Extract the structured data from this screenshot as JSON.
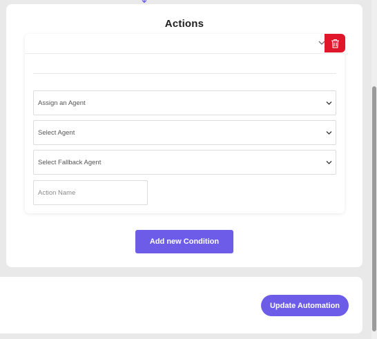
{
  "actions_section": {
    "title": "Actions"
  },
  "action_card": {
    "fields": {
      "assign": {
        "label": "Assign an Agent"
      },
      "agent": {
        "label": "Select Agent"
      },
      "fallback": {
        "label": "Select Fallback Agent"
      },
      "action_name": {
        "placeholder": "Action Name",
        "value": ""
      }
    }
  },
  "buttons": {
    "add_condition": "Add new Condition",
    "update_automation": "Update Automation"
  },
  "colors": {
    "accent": "#6c5ce7",
    "danger": "#e0162b",
    "background": "#e9e9ea"
  },
  "icons": {
    "connector": "arrow-down-icon",
    "collapse": "chevron-down-icon",
    "delete": "trash-icon",
    "dropdown": "chevron-down-icon"
  }
}
